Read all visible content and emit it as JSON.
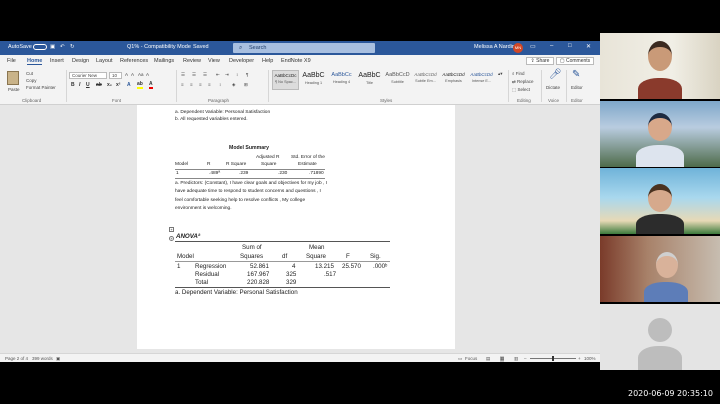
{
  "titlebar": {
    "autosave_label": "AutoSave",
    "autosave_state": "Off",
    "doc_name": "Q1% - Compatibility Mode",
    "saved_state": "Saved",
    "search_placeholder": "Search",
    "user_name": "Melissa A Nardin",
    "user_initials": "MN"
  },
  "menu": {
    "tabs": [
      "File",
      "Home",
      "Insert",
      "Design",
      "Layout",
      "References",
      "Mailings",
      "Review",
      "View",
      "Developer",
      "Help",
      "EndNote X9"
    ],
    "share_label": "Share",
    "comments_label": "Comments"
  },
  "ribbon": {
    "paste_label": "Paste",
    "cut_label": "Cut",
    "copy_label": "Copy",
    "format_painter_label": "Format Painter",
    "clipboard_label": "Clipboard",
    "font_name": "Courier New",
    "font_size": "10",
    "font_label": "Font",
    "paragraph_label": "Paragraph",
    "styles": [
      {
        "preview": "AaBbCcDc",
        "name": "¶ No Spac..."
      },
      {
        "preview": "AaBbC",
        "name": "Heading 1"
      },
      {
        "preview": "AaBbCc",
        "name": "Heading 4"
      },
      {
        "preview": "AaBbC",
        "name": "Title"
      },
      {
        "preview": "AaBbCcD",
        "name": "Subtitle"
      },
      {
        "preview": "AaBbCcDd",
        "name": "Subtle Em..."
      },
      {
        "preview": "AaBbCcDd",
        "name": "Emphasis"
      },
      {
        "preview": "AaBbCcDd",
        "name": "Intense E..."
      }
    ],
    "styles_label": "Styles",
    "find_label": "Find",
    "replace_label": "Replace",
    "select_label": "Select",
    "editing_label": "Editing",
    "dictate_label": "Dictate",
    "voice_label": "Voice",
    "editor_label": "Editor"
  },
  "document": {
    "note_dependent_top": "a. Dependent Variable: Personal Satisfaction",
    "note_all_vars": "b. All requested variables entered.",
    "model_summary_title": "Model Summary",
    "ms_headers": {
      "model": "Model",
      "r": "R",
      "r_square": "R Square",
      "adjusted_top": "Adjusted R",
      "adjusted_bottom": "Square",
      "std_err_top": "Std. Error of the",
      "std_err_bottom": "Estimate"
    },
    "ms_row": {
      "model": "1",
      "r": ".489ª",
      "r_square": ".239",
      "adjusted": ".230",
      "std_err": ".71890"
    },
    "predictors": [
      "a. Predictors: (Constant), I have clear goals and objectives for my job , I",
      "have adequate time to respond to student concerns and questions , I",
      "feel comfortable seeking help to resolve conflicts , My college",
      "environment is welcoming."
    ],
    "anova_title": "ANOVAª",
    "anova_headers": {
      "model": "Model",
      "sum_top": "Sum of",
      "sum_bottom": "Squares",
      "df": "df",
      "mean_top": "Mean",
      "mean_bottom": "Square",
      "f": "F",
      "sig": "Sig."
    },
    "anova_rows": [
      {
        "model": "1",
        "label": "Regression",
        "ss": "52.861",
        "df": "4",
        "ms": "13.215",
        "f": "25.570",
        "sig": ".000ᵇ"
      },
      {
        "model": "",
        "label": "Residual",
        "ss": "167.967",
        "df": "325",
        "ms": ".517",
        "f": "",
        "sig": ""
      },
      {
        "model": "",
        "label": "Total",
        "ss": "220.828",
        "df": "329",
        "ms": "",
        "f": "",
        "sig": ""
      }
    ],
    "anova_note": "a. Dependent Variable: Personal Satisfaction"
  },
  "statusbar": {
    "page": "Page 2 of 4",
    "words": "399 words",
    "focus": "Focus",
    "zoom": "100%"
  },
  "colors": {
    "word_blue": "#2b579a",
    "ribbon_bg": "#f3f3f3",
    "doc_bg": "#e6e6e6"
  },
  "overlay": {
    "timestamp": "2020-06-09  20:35:10"
  }
}
